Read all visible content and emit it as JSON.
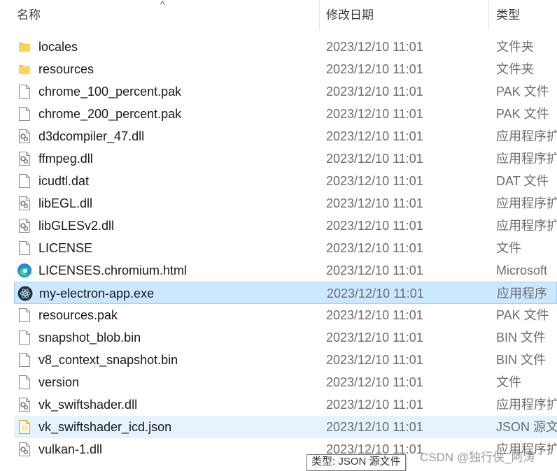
{
  "columns": {
    "name": "名称",
    "date": "修改日期",
    "type": "类型",
    "sort_indicator": "^"
  },
  "files": [
    {
      "name": "locales",
      "date": "2023/12/10 11:01",
      "type": "文件夹",
      "icon": "folder-icon"
    },
    {
      "name": "resources",
      "date": "2023/12/10 11:01",
      "type": "文件夹",
      "icon": "folder-icon"
    },
    {
      "name": "chrome_100_percent.pak",
      "date": "2023/12/10 11:01",
      "type": "PAK 文件",
      "icon": "file-icon"
    },
    {
      "name": "chrome_200_percent.pak",
      "date": "2023/12/10 11:01",
      "type": "PAK 文件",
      "icon": "file-icon"
    },
    {
      "name": "d3dcompiler_47.dll",
      "date": "2023/12/10 11:01",
      "type": "应用程序扩",
      "icon": "dll-icon"
    },
    {
      "name": "ffmpeg.dll",
      "date": "2023/12/10 11:01",
      "type": "应用程序扩",
      "icon": "dll-icon"
    },
    {
      "name": "icudtl.dat",
      "date": "2023/12/10 11:01",
      "type": "DAT 文件",
      "icon": "file-icon"
    },
    {
      "name": "libEGL.dll",
      "date": "2023/12/10 11:01",
      "type": "应用程序扩",
      "icon": "dll-icon"
    },
    {
      "name": "libGLESv2.dll",
      "date": "2023/12/10 11:01",
      "type": "应用程序扩",
      "icon": "dll-icon"
    },
    {
      "name": "LICENSE",
      "date": "2023/12/10 11:01",
      "type": "文件",
      "icon": "file-icon"
    },
    {
      "name": "LICENSES.chromium.html",
      "date": "2023/12/10 11:01",
      "type": "Microsoft",
      "icon": "edge-icon"
    },
    {
      "name": "my-electron-app.exe",
      "date": "2023/12/10 11:01",
      "type": "应用程序",
      "icon": "electron-icon",
      "state": "selected"
    },
    {
      "name": "resources.pak",
      "date": "2023/12/10 11:01",
      "type": "PAK 文件",
      "icon": "file-icon"
    },
    {
      "name": "snapshot_blob.bin",
      "date": "2023/12/10 11:01",
      "type": "BIN 文件",
      "icon": "file-icon"
    },
    {
      "name": "v8_context_snapshot.bin",
      "date": "2023/12/10 11:01",
      "type": "BIN 文件",
      "icon": "file-icon"
    },
    {
      "name": "version",
      "date": "2023/12/10 11:01",
      "type": "文件",
      "icon": "file-icon"
    },
    {
      "name": "vk_swiftshader.dll",
      "date": "2023/12/10 11:01",
      "type": "应用程序扩",
      "icon": "dll-icon"
    },
    {
      "name": "vk_swiftshader_icd.json",
      "date": "2023/12/10 11:01",
      "type": "JSON 源文",
      "icon": "json-icon",
      "state": "hover"
    },
    {
      "name": "vulkan-1.dll",
      "date": "2023/12/10 11:01",
      "type": "应用程序扩",
      "icon": "dll-icon"
    }
  ],
  "tooltip": "类型: JSON 源文件",
  "watermark": "CSDN @独行侠_阿涛",
  "colors": {
    "selected_bg": "#cce8ff",
    "selected_border": "#99d1ff",
    "hover_bg": "#e5f3ff",
    "folder": "#f8c53a"
  }
}
